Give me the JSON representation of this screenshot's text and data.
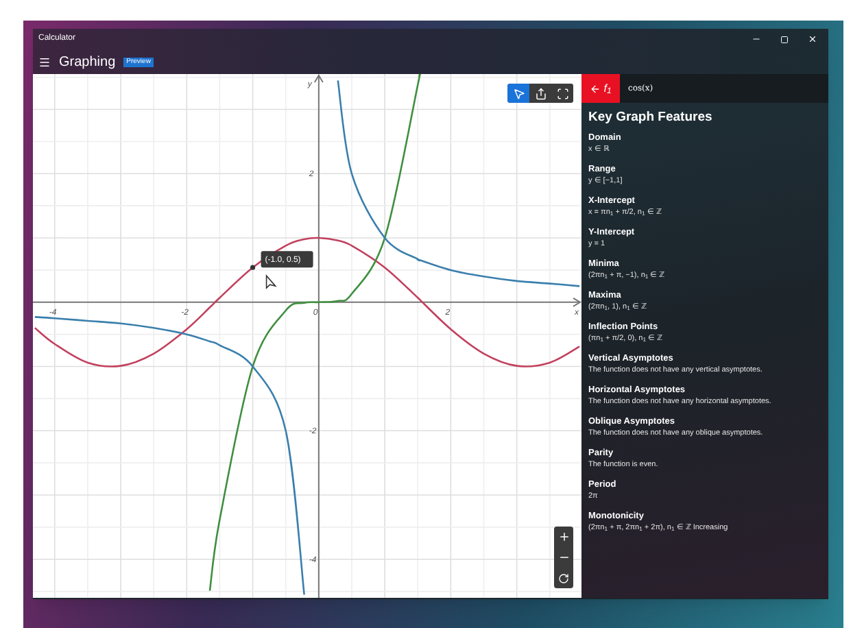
{
  "window": {
    "title": "Calculator"
  },
  "nav": {
    "title": "Graphing",
    "badge": "Preview"
  },
  "graph": {
    "toolbar": [
      {
        "kind": "trace",
        "selected": true
      },
      {
        "kind": "share",
        "selected": false
      },
      {
        "kind": "fit",
        "selected": false
      }
    ],
    "zoom_controls": [
      {
        "kind": "zoom-in"
      },
      {
        "kind": "zoom-out"
      },
      {
        "kind": "reset"
      }
    ],
    "chart_data": {
      "type": "line",
      "xlabel": "x",
      "ylabel": "y",
      "xlim": [
        -4.33,
        3.98
      ],
      "ylim": [
        -4.6,
        3.55
      ],
      "xticks": [
        -4,
        -2,
        0,
        2
      ],
      "yticks": [
        -4,
        -2,
        2
      ],
      "grid": true,
      "x": [
        -4.3,
        -4,
        -3.5,
        -3,
        -2.5,
        -2,
        -1.65,
        -1.5,
        -1,
        -0.5,
        -0.22,
        0,
        0.29,
        0.5,
        1,
        1.5,
        1.52,
        2,
        2.5,
        3,
        3.5,
        3.95
      ],
      "series": [
        {
          "color": "#c2405e",
          "values": [
            -0.4,
            -0.65,
            -0.94,
            -0.99,
            -0.8,
            -0.42,
            -0.08,
            0.07,
            0.54,
            0.88,
            0.98,
            1,
            0.96,
            0.88,
            0.54,
            0.07,
            0.05,
            -0.42,
            -0.8,
            -0.99,
            -0.94,
            -0.69
          ]
        },
        {
          "color": "#3f8f3f",
          "values": [
            null,
            null,
            null,
            null,
            null,
            null,
            -4.49,
            -3.38,
            -1,
            -0.13,
            -0.01,
            0,
            0.02,
            0.13,
            1,
            3.38,
            3.51,
            null,
            null,
            null,
            null,
            null
          ]
        },
        {
          "color": "#3a7fad",
          "values": [
            -0.23,
            -0.25,
            -0.29,
            -0.33,
            -0.4,
            -0.5,
            -0.61,
            -0.67,
            -1,
            -2,
            -4.55,
            null,
            3.45,
            2,
            1,
            0.67,
            0.66,
            0.5,
            0.4,
            0.33,
            0.29,
            0.25
          ]
        }
      ],
      "annotations": [
        {
          "text": "(-1.0, 0.5)",
          "x": -1,
          "y": 0.54
        }
      ]
    }
  },
  "panel": {
    "function_label": "f$_{1}$",
    "expression": "cos(x)",
    "title": "Key Graph Features",
    "features": [
      {
        "title": "Domain",
        "value": "x ∈ ℝ"
      },
      {
        "title": "Range",
        "value": "y ∈ [−1,1]"
      },
      {
        "title": "X-Intercept",
        "value": "x = πn$_{1}$ + π/2, n$_{1}$ ∈ ℤ"
      },
      {
        "title": "Y-Intercept",
        "value": "y = 1"
      },
      {
        "title": "Minima",
        "value": "(2πn$_{1}$ + π, −1), n$_{1}$ ∈ ℤ"
      },
      {
        "title": "Maxima",
        "value": "(2πn$_{1}$, 1), n$_{1}$ ∈ ℤ"
      },
      {
        "title": "Inflection Points",
        "value": "(πn$_{1}$ + π/2, 0), n$_{1}$ ∈ ℤ"
      },
      {
        "title": "Vertical Asymptotes",
        "value": "The function does not have any vertical asymptotes."
      },
      {
        "title": "Horizontal Asymptotes",
        "value": "The function does not have any horizontal asymptotes."
      },
      {
        "title": "Oblique Asymptotes",
        "value": "The function does not have any oblique asymptotes."
      },
      {
        "title": "Parity",
        "value": "The function is even."
      },
      {
        "title": "Period",
        "value": "2π"
      },
      {
        "title": "Monotonicity",
        "value": "(2πn$_{1}$ + π, 2πn$_{1}$ + 2π), n$_{1}$ ∈ ℤ Increasing"
      }
    ]
  }
}
